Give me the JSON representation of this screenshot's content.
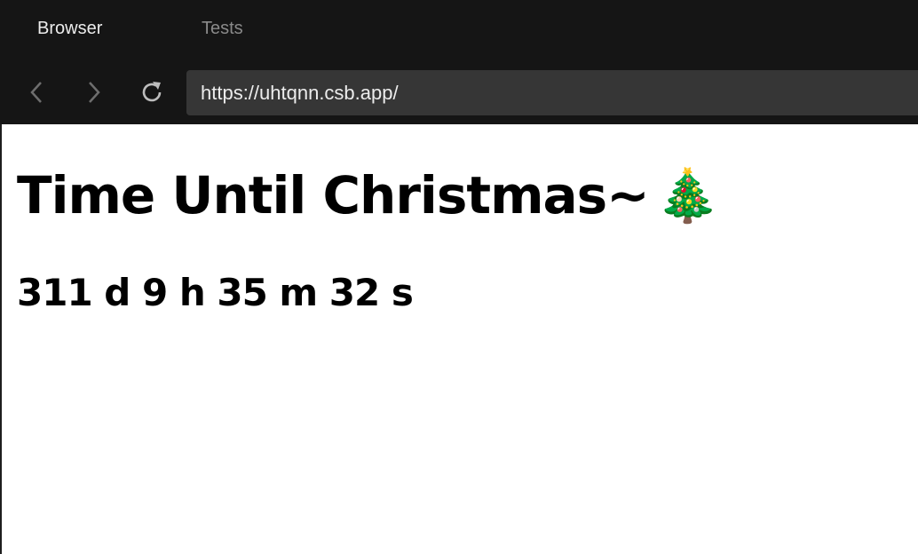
{
  "tabs": [
    {
      "label": "Browser",
      "active": true
    },
    {
      "label": "Tests",
      "active": false
    }
  ],
  "nav": {
    "back_icon": "chevron-left-icon",
    "forward_icon": "chevron-right-icon",
    "reload_icon": "reload-icon",
    "url": "https://uhtqnn.csb.app/"
  },
  "page": {
    "title": "Time Until Christmas~",
    "title_emoji": "🎄",
    "countdown": "311 d 9 h 35 m 32 s"
  },
  "colors": {
    "chrome_background": "#151515",
    "url_bar_background": "#363636",
    "active_tab_text": "#ececec",
    "inactive_tab_text": "#8a8a8a",
    "page_background": "#ffffff",
    "text": "#000000"
  }
}
